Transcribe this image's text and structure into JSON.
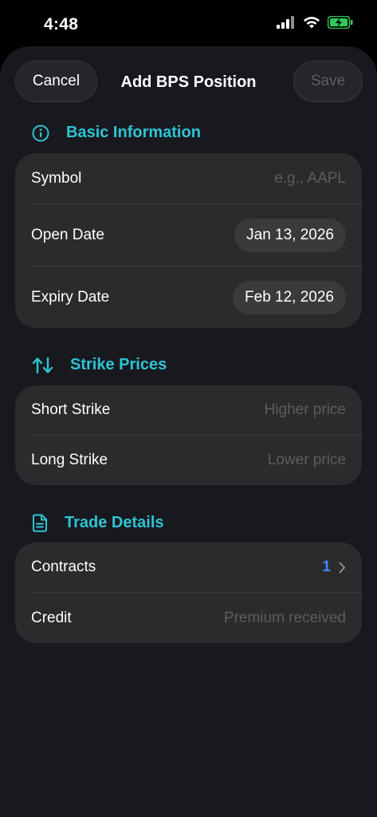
{
  "status_bar": {
    "time": "4:48"
  },
  "nav": {
    "cancel_label": "Cancel",
    "title": "Add BPS Position",
    "save_label": "Save"
  },
  "sections": {
    "basic": {
      "title": "Basic Information",
      "icon": "info-circle-icon",
      "symbol_label": "Symbol",
      "symbol_placeholder": "e.g., AAPL",
      "open_date_label": "Open Date",
      "open_date_value": "Jan 13, 2026",
      "expiry_date_label": "Expiry Date",
      "expiry_date_value": "Feb 12, 2026"
    },
    "strikes": {
      "title": "Strike Prices",
      "icon": "up-down-arrows-icon",
      "short_label": "Short Strike",
      "short_placeholder": "Higher price",
      "long_label": "Long Strike",
      "long_placeholder": "Lower price"
    },
    "trade": {
      "title": "Trade Details",
      "icon": "document-icon",
      "contracts_label": "Contracts",
      "contracts_value": "1",
      "credit_label": "Credit",
      "credit_placeholder": "Premium received"
    }
  },
  "colors": {
    "accent_teal": "#2ec4d3",
    "accent_blue": "#3d8bff",
    "battery_green": "#34c759",
    "background": "#17191f",
    "card": "#2b2b2d"
  }
}
